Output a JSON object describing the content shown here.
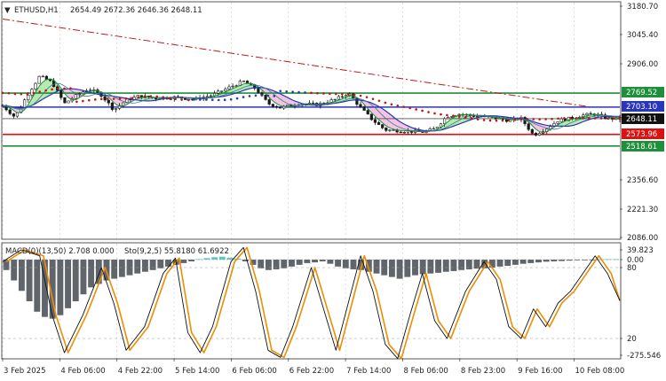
{
  "header": {
    "symbol": "ETHUSD,H1",
    "ohlc": "2654.49 2672.36 2646.36 2648.11"
  },
  "indicator_header": {
    "macd": "MACD(0)(13,50) 2.708 0.000",
    "stoch": "Sto(9,2,5) 55.8180 61.6922"
  },
  "colors": {
    "background": "#ffffff",
    "grid": "#c8c8c8",
    "candle": "#1a1a1a",
    "ma_green": "#1e8f3a",
    "ma_blue": "#2a35b8",
    "sar_red": "#cc1111",
    "trend_red": "#c01818",
    "cloud_green": "#a8e6a0",
    "cloud_pink": "#f2b8dc",
    "level_green": "#1e8f3a",
    "level_blue": "#2a35b8",
    "level_red": "#dd1111",
    "price_tag": "#111111",
    "hist_gray": "#5f656b",
    "hist_cyan": "#5cc9c9",
    "stoch_main": "#111111",
    "stoch_signal": "#f08c00"
  },
  "chart_data": [
    {
      "type": "candlestick",
      "title": "ETHUSD,H1",
      "price_axis": {
        "ticks": [
          "3180.70",
          "3045.40",
          "2906.00",
          "2769.52",
          "2703.10",
          "2648.11",
          "2573.96",
          "2518.61",
          "2356.60",
          "2221.30",
          "2086.00"
        ],
        "ylim": [
          2086.0,
          3180.7
        ]
      },
      "levels": [
        {
          "price": 2769.52,
          "label": "2769.52",
          "color": "#1e8f3a"
        },
        {
          "price": 2703.1,
          "label": "2703.10",
          "color": "#2a35b8"
        },
        {
          "price": 2648.11,
          "label": "2648.11",
          "color": "#111111"
        },
        {
          "price": 2573.96,
          "label": "2573.96",
          "color": "#dd1111"
        },
        {
          "price": 2518.61,
          "label": "2518.61",
          "color": "#1e8f3a"
        }
      ],
      "trendline": {
        "from": [
          0,
          3120
        ],
        "to": [
          0.95,
          2705
        ],
        "style": "dash-dot"
      },
      "x_axis": {
        "labels": [
          "3 Feb 2025",
          "4 Feb 06:00",
          "4 Feb 22:00",
          "5 Feb 14:00",
          "6 Feb 06:00",
          "6 Feb 22:00",
          "7 Feb 14:00",
          "8 Feb 06:00",
          "8 Feb 23:00",
          "9 Feb 16:00",
          "10 Feb 08:00"
        ]
      },
      "price_path": [
        [
          0.0,
          2710
        ],
        [
          0.02,
          2655
        ],
        [
          0.04,
          2760
        ],
        [
          0.06,
          2850
        ],
        [
          0.08,
          2820
        ],
        [
          0.1,
          2720
        ],
        [
          0.12,
          2760
        ],
        [
          0.14,
          2790
        ],
        [
          0.16,
          2760
        ],
        [
          0.18,
          2690
        ],
        [
          0.2,
          2735
        ],
        [
          0.22,
          2755
        ],
        [
          0.25,
          2745
        ],
        [
          0.28,
          2750
        ],
        [
          0.31,
          2740
        ],
        [
          0.34,
          2760
        ],
        [
          0.37,
          2800
        ],
        [
          0.39,
          2825
        ],
        [
          0.41,
          2790
        ],
        [
          0.43,
          2720
        ],
        [
          0.45,
          2700
        ],
        [
          0.48,
          2720
        ],
        [
          0.51,
          2715
        ],
        [
          0.54,
          2740
        ],
        [
          0.56,
          2770
        ],
        [
          0.58,
          2700
        ],
        [
          0.6,
          2640
        ],
        [
          0.62,
          2595
        ],
        [
          0.65,
          2590
        ],
        [
          0.68,
          2585
        ],
        [
          0.7,
          2600
        ],
        [
          0.72,
          2660
        ],
        [
          0.74,
          2670
        ],
        [
          0.77,
          2660
        ],
        [
          0.8,
          2650
        ],
        [
          0.82,
          2640
        ],
        [
          0.84,
          2650
        ],
        [
          0.86,
          2570
        ],
        [
          0.88,
          2600
        ],
        [
          0.9,
          2640
        ],
        [
          0.92,
          2650
        ],
        [
          0.94,
          2665
        ],
        [
          0.96,
          2670
        ],
        [
          0.98,
          2650
        ],
        [
          1.0,
          2648
        ]
      ]
    },
    {
      "type": "histogram+line",
      "title": "MACD(0)(13,50) 2.708 0.000 / Sto(9,2,5) 55.8180 61.6922",
      "axis": {
        "ticks": [
          "39.823",
          "0.00",
          "80",
          "20",
          "-275.546"
        ],
        "ylim": [
          -275.546,
          39.823
        ]
      },
      "stoch_levels": [
        80,
        20
      ],
      "stoch_points": [
        [
          0.0,
          85
        ],
        [
          0.03,
          95
        ],
        [
          0.06,
          90
        ],
        [
          0.08,
          40
        ],
        [
          0.1,
          8
        ],
        [
          0.13,
          40
        ],
        [
          0.16,
          80
        ],
        [
          0.18,
          50
        ],
        [
          0.2,
          10
        ],
        [
          0.23,
          30
        ],
        [
          0.26,
          75
        ],
        [
          0.28,
          88
        ],
        [
          0.3,
          25
        ],
        [
          0.32,
          8
        ],
        [
          0.34,
          30
        ],
        [
          0.37,
          85
        ],
        [
          0.39,
          97
        ],
        [
          0.41,
          60
        ],
        [
          0.43,
          10
        ],
        [
          0.45,
          4
        ],
        [
          0.47,
          30
        ],
        [
          0.5,
          80
        ],
        [
          0.52,
          45
        ],
        [
          0.54,
          10
        ],
        [
          0.56,
          50
        ],
        [
          0.58,
          90
        ],
        [
          0.6,
          60
        ],
        [
          0.62,
          15
        ],
        [
          0.64,
          3
        ],
        [
          0.66,
          40
        ],
        [
          0.68,
          75
        ],
        [
          0.7,
          35
        ],
        [
          0.72,
          20
        ],
        [
          0.75,
          60
        ],
        [
          0.78,
          85
        ],
        [
          0.8,
          70
        ],
        [
          0.82,
          30
        ],
        [
          0.84,
          20
        ],
        [
          0.86,
          45
        ],
        [
          0.88,
          30
        ],
        [
          0.9,
          50
        ],
        [
          0.92,
          60
        ],
        [
          0.94,
          75
        ],
        [
          0.96,
          90
        ],
        [
          0.98,
          75
        ],
        [
          1.0,
          52
        ]
      ],
      "histogram": [
        -30,
        -60,
        -90,
        -120,
        -150,
        -165,
        -170,
        -160,
        -140,
        -120,
        -100,
        -80,
        -70,
        -60,
        -55,
        -50,
        -45,
        -40,
        -35,
        -30,
        -25,
        -20,
        -15,
        -10,
        -5,
        2,
        6,
        10,
        12,
        8,
        4,
        -5,
        -15,
        -25,
        -30,
        -28,
        -25,
        -20,
        -15,
        -10,
        -8,
        -5,
        -12,
        -20,
        -25,
        -28,
        -30,
        -35,
        -40,
        -45,
        -50,
        -55,
        -50,
        -45,
        -42,
        -40,
        -38,
        -35,
        -33,
        -30,
        -28,
        -26,
        -25,
        -23,
        -20,
        -18,
        -15,
        -12,
        -10,
        -8,
        -6,
        -5,
        -4,
        -3,
        -2,
        -1,
        0,
        1,
        2,
        2
      ]
    }
  ]
}
